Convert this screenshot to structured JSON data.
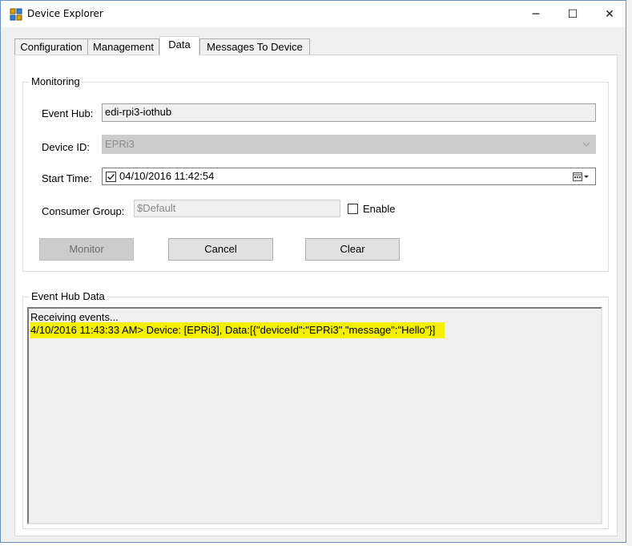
{
  "window": {
    "title": "Device Explorer",
    "controls": {
      "minimize": "─",
      "maximize": "☐",
      "close": "✕"
    }
  },
  "tabs": [
    {
      "label": "Configuration",
      "active": false
    },
    {
      "label": "Management",
      "active": false
    },
    {
      "label": "Data",
      "active": true
    },
    {
      "label": "Messages To Device",
      "active": false
    }
  ],
  "monitoring": {
    "legend": "Monitoring",
    "event_hub_label": "Event Hub:",
    "event_hub_value": "edi-rpi3-iothub",
    "device_id_label": "Device ID:",
    "device_id_value": "EPRi3",
    "start_time_label": "Start Time:",
    "start_time_checked": true,
    "start_time_value": "04/10/2016 11:42:54",
    "consumer_group_label": "Consumer Group:",
    "consumer_group_value": "$Default",
    "enable_label": "Enable",
    "enable_checked": false,
    "monitor_button": "Monitor",
    "cancel_button": "Cancel",
    "clear_button": "Clear"
  },
  "event_hub_data": {
    "legend": "Event Hub Data",
    "line1": "Receiving events...",
    "line2_prefix": "4/10/2016 11:43:33 AM> Device: [EPRi3], Data:",
    "line2_data": "[{\"deviceId\":\"EPRi3\",\"message\":\"Hello\"}]",
    "highlight_color": "#f4f100"
  }
}
